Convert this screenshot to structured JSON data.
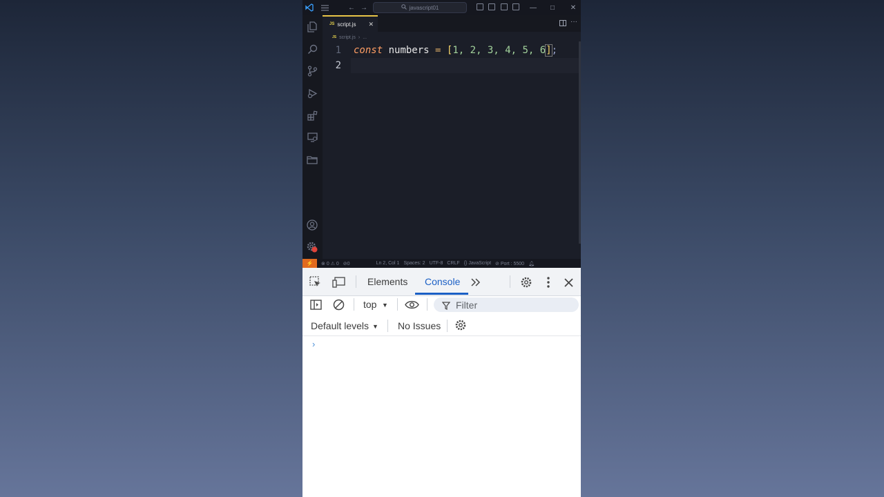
{
  "colors": {
    "accent_tab": "#e8c547",
    "statusbar_remote": "#e16a1f",
    "devtools_active": "#1a5fc5",
    "kw_const": "#ff9e64",
    "number": "#a3d39c"
  },
  "vscode": {
    "command_center": "javascript01",
    "tab": {
      "label": "script.js",
      "badge": "JS"
    },
    "breadcrumb": {
      "file": "script.js",
      "rest": "..."
    },
    "editor": {
      "lines": [
        {
          "number": "1",
          "tokens": {
            "kw": "const",
            "name": "numbers",
            "eq": "=",
            "open": "[",
            "values": "1, 2, 3, 4, 5, 6",
            "close": "]",
            "semi": ";"
          }
        },
        {
          "number": "2"
        }
      ]
    },
    "activity_icons": [
      "explorer-icon",
      "search-icon",
      "source-control-icon",
      "run-debug-icon",
      "extensions-icon",
      "remote-explorer-icon",
      "folder-icon",
      "account-icon",
      "manage-gear-icon"
    ],
    "statusbar": {
      "errors": "0",
      "warnings": "0",
      "ports": "0",
      "position": "Ln 2, Col 1",
      "spaces": "Spaces: 2",
      "encoding": "UTF-8",
      "eol": "CRLF",
      "language": "JavaScript",
      "port": "Port : 5500"
    }
  },
  "devtools": {
    "tabs": [
      "Elements",
      "Console"
    ],
    "active_tab": "Console",
    "context": "top",
    "filter_placeholder": "Filter",
    "levels": "Default levels",
    "issues": "No Issues",
    "prompt": "›"
  }
}
